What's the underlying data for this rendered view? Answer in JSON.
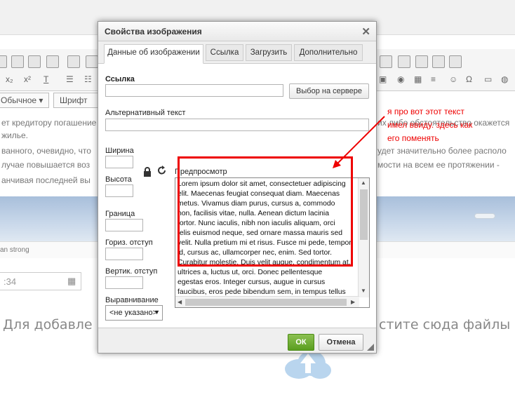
{
  "background": {
    "status_text": "an   strong",
    "date_value": ":34",
    "style_select": "Обычное",
    "font_select": "Шрифт",
    "text_lines_left": [
      "ет кредитору погашение",
      "жилье.",
      "ванного, очевидно, что",
      "лучае повышается воз",
      "анчивая последней вы"
    ],
    "text_lines_right": [
      "их либо обстоятельство окажется",
      "",
      "удет значительно более располо",
      "мости на всем ее протяжении -",
      ""
    ],
    "drop_text_left": "Для добавле",
    "drop_text_right": "стите сюда файлы"
  },
  "dialog": {
    "title": "Свойства изображения",
    "close_symbol": "✕",
    "tabs": [
      {
        "label": "Данные об изображении",
        "active": true
      },
      {
        "label": "Ссылка",
        "active": false
      },
      {
        "label": "Загрузить",
        "active": false
      },
      {
        "label": "Дополнительно",
        "active": false
      }
    ],
    "link_label": "Ссылка",
    "link_value": "",
    "browse_server_label": "Выбор на сервере",
    "alt_label": "Альтернативный текст",
    "alt_value": "",
    "width_label": "Ширина",
    "height_label": "Высота",
    "border_label": "Граница",
    "hspace_label": "Гориз. отступ",
    "vspace_label": "Вертик. отступ",
    "align_label": "Выравнивание",
    "align_value": "<не указано>",
    "preview_label": "Предпросмотр",
    "preview_lines": [
      "Lorem ipsum dolor sit amet, consectetuer adipiscing",
      "elit. Maecenas feugiat consequat diam. Maecenas",
      "metus. Vivamus diam purus, cursus a, commodo",
      "non, facilisis vitae, nulla. Aenean dictum lacinia",
      "tortor. Nunc iaculis, nibh non iaculis aliquam, orci",
      "felis euismod neque, sed ornare massa mauris sed",
      "velit. Nulla pretium mi et risus. Fusce mi pede, tempor",
      "id, cursus ac, ullamcorper nec, enim. Sed tortor.",
      "Curabitur molestie. Duis velit augue, condimentum at,",
      "ultrices a, luctus ut, orci. Donec pellentesque",
      "egestas eros. Integer cursus, augue in cursus",
      "faucibus, eros pede bibendum sem, in tempus tellus"
    ],
    "ok_label": "ОК",
    "cancel_label": "Отмена"
  },
  "annotation": {
    "lines": [
      "я про вот этот текст",
      "имел ввиду. здесь как",
      "его поменять"
    ],
    "color": "#e00000"
  },
  "colors": {
    "accent_green": "#5a9e1f",
    "annotation_red": "#e00000"
  }
}
